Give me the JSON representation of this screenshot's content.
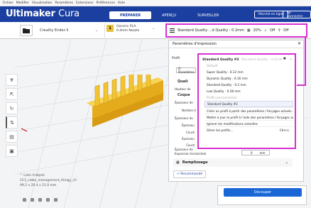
{
  "menu": [
    "Fichier",
    "Modifier",
    "Visualisation",
    "Paramètres",
    "Extensions",
    "Préférences",
    "Aide"
  ],
  "app": {
    "brand": "Ultimaker",
    "product": "Cura"
  },
  "stages": [
    "PRÉPARER",
    "APERÇU",
    "SURVEILLER"
  ],
  "header_buttons": {
    "marketplace": "Marché en ligne",
    "signin": "Se connecter"
  },
  "printer": {
    "name": "Creality Ender-3"
  },
  "material": {
    "badge": "1",
    "type": "Generic PLA",
    "nozzle": "0.4mm Nozzle"
  },
  "profile_bar": {
    "text": "Standard Quality ...d Quality - 0.2mm",
    "infill": "20%",
    "support": "Off",
    "adhesion": "Off"
  },
  "panel": {
    "title": "Paramètres d'impression",
    "profile_label": "Profil",
    "search_placeholder": "Q Paramètres",
    "rows": [
      "Quali",
      "Hauteur de",
      "Coque",
      "Épaisseur de",
      "Nombre d",
      "Épaisseur du",
      "Épaisseu",
      "Couch",
      "Épaisseu",
      "Couch",
      "Épaisseur de"
    ],
    "expansion_label": "Expansion horizontale",
    "expansion_value": "0",
    "expansion_unit": "mm",
    "infill_section": "Remplissage",
    "recommended_button": "< Recommandé"
  },
  "dropdown": {
    "current": "Standard Quality #2",
    "current_info": "Standard Quality - 0.2mm",
    "default_header": "Default",
    "defaults": [
      "Super Quality - 0.12 mm",
      "Dynamic Quality - 0.16 mm",
      "Standard Quality - 0.2 mm",
      "Low Quality - 0.28 mm"
    ],
    "custom_header": "Profils personnalisés",
    "custom": [
      "Standard Quality #2"
    ],
    "actions": [
      {
        "label": "Créer un profil à partir des paramètres / forçages actuels...",
        "shortcut": ""
      },
      {
        "label": "Mettre à jour le profil à l'aide des paramètres / forçages actuels",
        "shortcut": ""
      },
      {
        "label": "Ignorer les modifications actuelles",
        "shortcut": ""
      },
      {
        "label": "Gérer les profils...",
        "shortcut": "Ctrl+L"
      }
    ]
  },
  "object_info": {
    "list_toggle": "^ Liste d'objets",
    "filename": "CE3_cable_management_thingy_v5",
    "dimensions": "99.2 x 20.4 x 21.0 mm"
  },
  "slice_button": "Découper",
  "colors": {
    "brand_blue": "#1b3fa0",
    "highlight_magenta": "#d72ed1",
    "model_yellow": "#f2c530",
    "slice_blue": "#1966d6"
  }
}
